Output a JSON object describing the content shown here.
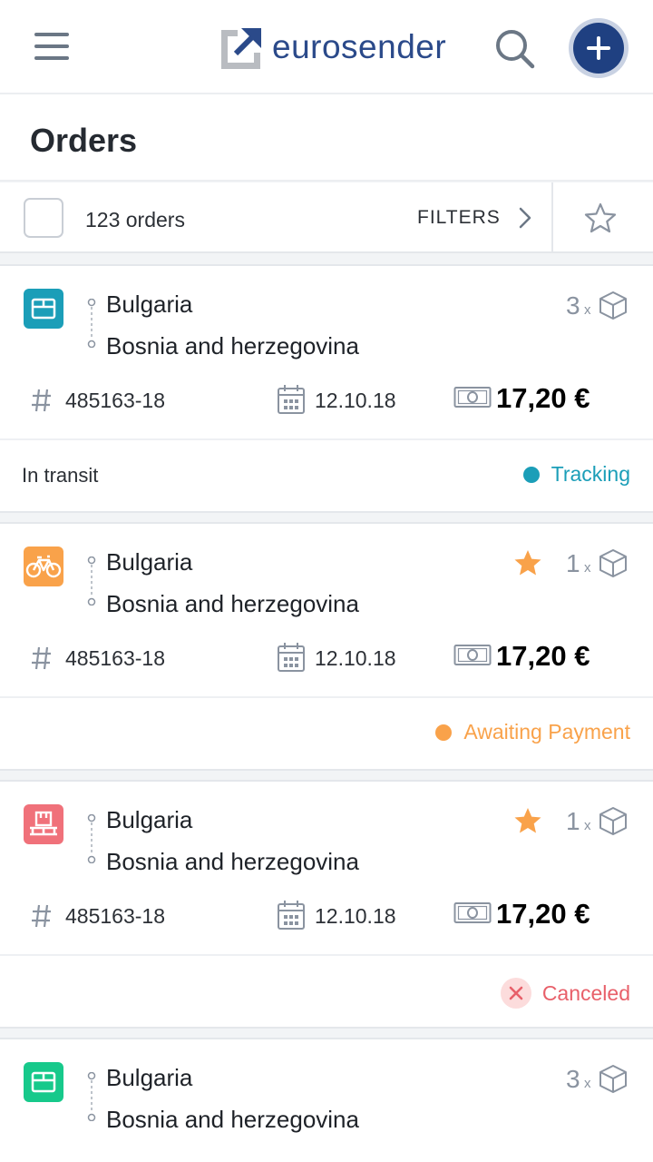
{
  "header": {
    "brand": "eurosender",
    "brand_color": "#2b4a8a",
    "menu_icon": "hamburger-menu-icon",
    "search_icon": "search-icon",
    "add_icon": "plus-icon"
  },
  "page": {
    "title": "Orders"
  },
  "toolbar": {
    "count_text": "123 orders",
    "filters_label": "FILTERS"
  },
  "orders": [
    {
      "service_icon": "box-icon",
      "service_color": "#1b9eb8",
      "from": "Bulgaria",
      "to": "Bosnia and herzegovina",
      "favorite": false,
      "quantity": "3",
      "quantity_suffix": "x",
      "order_number": "485163-18",
      "date": "12.10.18",
      "price": "17,20 €",
      "status_left": "In transit",
      "status": "Tracking",
      "status_color": "#1b9eb8"
    },
    {
      "service_icon": "bicycle-icon",
      "service_color": "#f9a24a",
      "from": "Bulgaria",
      "to": "Bosnia and herzegovina",
      "favorite": true,
      "quantity": "1",
      "quantity_suffix": "x",
      "order_number": "485163-18",
      "date": "12.10.18",
      "price": "17,20 €",
      "status_left": "",
      "status": "Awaiting Payment",
      "status_color": "#f9a24a"
    },
    {
      "service_icon": "pallet-icon",
      "service_color": "#f0717a",
      "from": "Bulgaria",
      "to": "Bosnia and herzegovina",
      "favorite": true,
      "quantity": "1",
      "quantity_suffix": "x",
      "order_number": "485163-18",
      "date": "12.10.18",
      "price": "17,20 €",
      "status_left": "",
      "status": "Canceled",
      "status_color": "#e8606a"
    },
    {
      "service_icon": "box-icon",
      "service_color": "#17c98b",
      "from": "Bulgaria",
      "to": "Bosnia and herzegovina",
      "favorite": false,
      "quantity": "3",
      "quantity_suffix": "x"
    }
  ]
}
